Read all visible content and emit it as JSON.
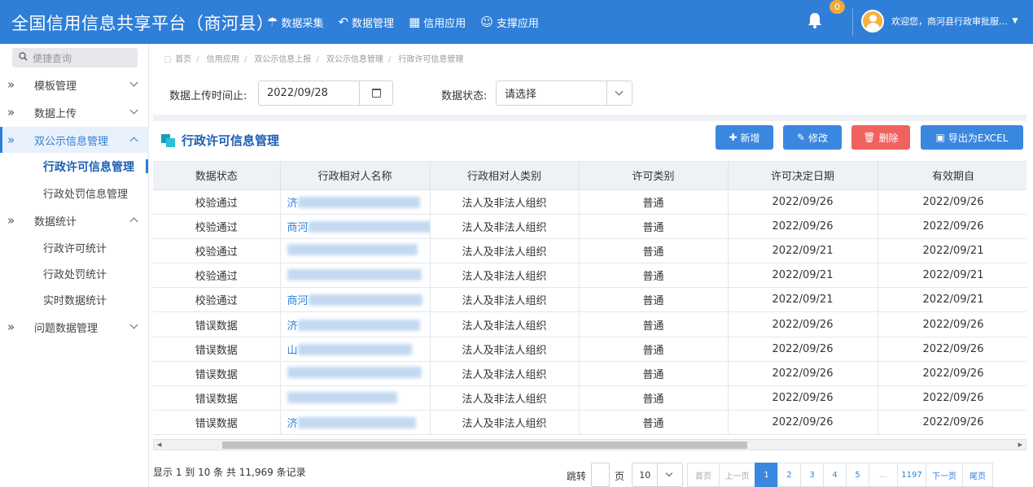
{
  "header": {
    "title": "全国信用信息共享平台（商河县）",
    "nav": [
      {
        "icon": "umbrella-icon",
        "glyph": "☂",
        "label": "数据采集"
      },
      {
        "icon": "reply-all-icon",
        "glyph": "↶",
        "label": "数据管理"
      },
      {
        "icon": "windows-icon",
        "glyph": "▦",
        "label": "信用应用"
      },
      {
        "icon": "smile-icon",
        "glyph": "☺",
        "label": "支撑应用"
      }
    ],
    "notification_count": "0",
    "user_text": "欢迎您，商河县行政审批服..."
  },
  "sidebar": {
    "search_placeholder": "便捷查询",
    "menu": [
      {
        "label": "模板管理"
      },
      {
        "label": "数据上传"
      },
      {
        "label": "双公示信息管理"
      },
      {
        "label": "数据统计"
      },
      {
        "label": "问题数据管理"
      }
    ],
    "submenu_dual": [
      "行政许可信息管理",
      "行政处罚信息管理"
    ],
    "submenu_stats": [
      "行政许可统计",
      "行政处罚统计",
      "实时数据统计"
    ]
  },
  "breadcrumb": [
    "首页",
    "信用应用",
    "双公示信息上报",
    "双公示信息管理",
    "行政许可信息管理"
  ],
  "filters": {
    "upload_time_label": "数据上传时间止:",
    "upload_time_value": "2022/09/28",
    "status_label": "数据状态:",
    "status_value": "请选择"
  },
  "section": {
    "title": "行政许可信息管理",
    "buttons": {
      "add": "新增",
      "edit": "修改",
      "delete": "删除",
      "export": "导出为EXCEL"
    }
  },
  "table": {
    "columns": [
      "数据状态",
      "行政相对人名称",
      "行政相对人类别",
      "许可类别",
      "许可决定日期",
      "有效期自"
    ],
    "rows": [
      {
        "status": "校验通过",
        "name": "济",
        "category": "法人及非法人组织",
        "type": "普通",
        "decision_date": "2022/09/26",
        "valid_from": "2022/09/26"
      },
      {
        "status": "校验通过",
        "name": "商河",
        "category": "法人及非法人组织",
        "type": "普通",
        "decision_date": "2022/09/26",
        "valid_from": "2022/09/26"
      },
      {
        "status": "校验通过",
        "name": "",
        "category": "法人及非法人组织",
        "type": "普通",
        "decision_date": "2022/09/21",
        "valid_from": "2022/09/21"
      },
      {
        "status": "校验通过",
        "name": "",
        "category": "法人及非法人组织",
        "type": "普通",
        "decision_date": "2022/09/21",
        "valid_from": "2022/09/21"
      },
      {
        "status": "校验通过",
        "name": "商河",
        "category": "法人及非法人组织",
        "type": "普通",
        "decision_date": "2022/09/21",
        "valid_from": "2022/09/21"
      },
      {
        "status": "错误数据",
        "name": "济",
        "category": "法人及非法人组织",
        "type": "普通",
        "decision_date": "2022/09/26",
        "valid_from": "2022/09/26"
      },
      {
        "status": "错误数据",
        "name": "山",
        "category": "法人及非法人组织",
        "type": "普通",
        "decision_date": "2022/09/26",
        "valid_from": "2022/09/26"
      },
      {
        "status": "错误数据",
        "name": "",
        "category": "法人及非法人组织",
        "type": "普通",
        "decision_date": "2022/09/26",
        "valid_from": "2022/09/26"
      },
      {
        "status": "错误数据",
        "name": "",
        "category": "法人及非法人组织",
        "type": "普通",
        "decision_date": "2022/09/26",
        "valid_from": "2022/09/26"
      },
      {
        "status": "错误数据",
        "name": "济",
        "category": "法人及非法人组织",
        "type": "普通",
        "decision_date": "2022/09/26",
        "valid_from": "2022/09/26"
      }
    ]
  },
  "footer": {
    "summary": "显示 1 到 10 条 共 11,969 条记录",
    "jump_label": "跳转",
    "page_label": "页",
    "page_size": "10",
    "pagination": {
      "first": "首页",
      "prev": "上一页",
      "pages": [
        "1",
        "2",
        "3",
        "4",
        "5",
        "...",
        "1197"
      ],
      "current": "1",
      "next": "下一页",
      "last": "尾页"
    }
  },
  "colors": {
    "primary": "#2f7fd8",
    "danger": "#f0625e",
    "badge": "#f0a93a",
    "header_bg": "#eef1f6"
  }
}
